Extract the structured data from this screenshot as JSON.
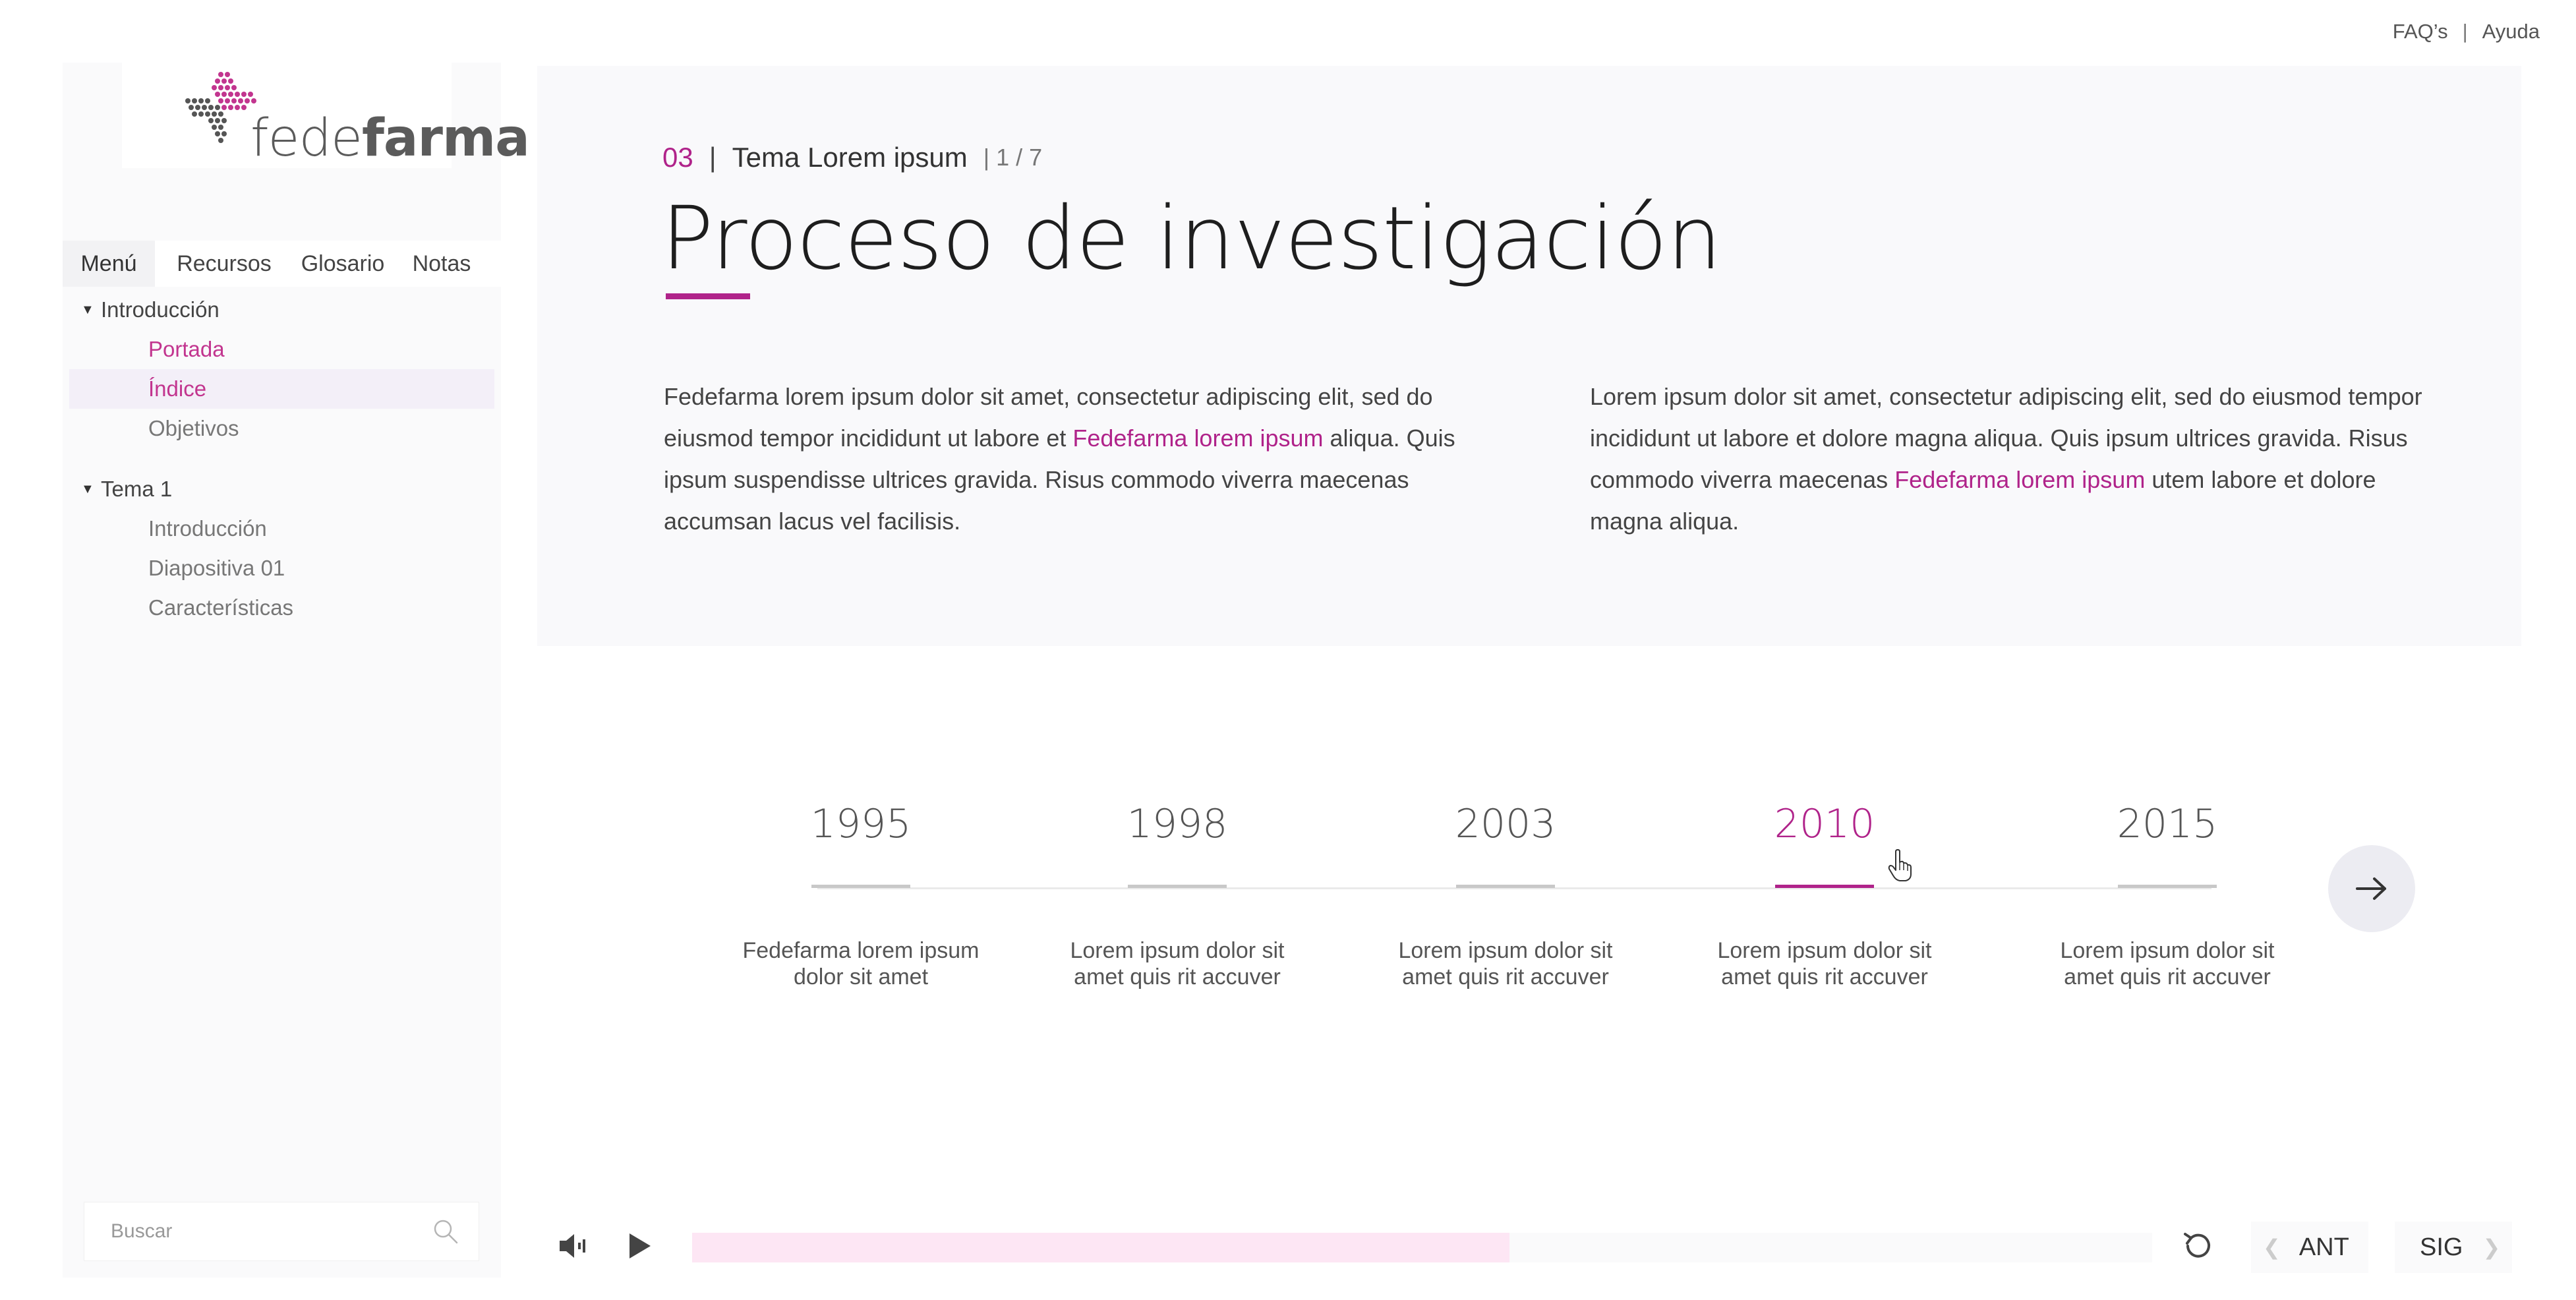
{
  "top_links": {
    "faq": "FAQ’s",
    "separator": "|",
    "help": "Ayuda"
  },
  "logo": {
    "text_light": "fede",
    "text_bold": "farma"
  },
  "sidebar": {
    "tabs": [
      {
        "label": "Menú",
        "active": true
      },
      {
        "label": "Recursos",
        "active": false
      },
      {
        "label": "Glosario",
        "active": false
      },
      {
        "label": "Notas",
        "active": false
      }
    ],
    "groups": [
      {
        "title": "Introducción",
        "items": [
          {
            "label": "Portada",
            "state": "visited"
          },
          {
            "label": "Índice",
            "state": "current"
          },
          {
            "label": "Objetivos",
            "state": "default"
          }
        ]
      },
      {
        "title": "Tema 1",
        "items": [
          {
            "label": "Introducción",
            "state": "default"
          },
          {
            "label": "Diapositiva 01",
            "state": "default"
          },
          {
            "label": "Características",
            "state": "default"
          }
        ]
      }
    ],
    "search_placeholder": "Buscar"
  },
  "header": {
    "number": "03",
    "separator": "|",
    "topic": "Tema Lorem ipsum",
    "pages": "| 1 / 7",
    "title": "Proceso de investigación"
  },
  "paragraphs": {
    "left": {
      "before": "Fedefarma lorem ipsum dolor sit amet, consectetur adipiscing elit, sed do eiusmod tempor incididunt ut labore et ",
      "highlight": "Fedefarma lorem ipsum",
      "after": " aliqua. Quis ipsum suspendisse ultrices gravida. Risus commodo viverra maecenas accumsan lacus vel facilisis."
    },
    "right": {
      "before": "Lorem ipsum dolor sit amet, consectetur adipiscing elit, sed do eiusmod tempor incididunt ut labore et dolore magna aliqua. Quis ipsum ultrices gravida. Risus commodo viverra maecenas ",
      "highlight": "Fedefarma lorem ipsum",
      "after": " utem labore et dolore magna aliqua."
    }
  },
  "timeline": [
    {
      "year": "1995",
      "desc_line1": "Fedefarma lorem ipsum",
      "desc_line2": "dolor sit amet",
      "active": false
    },
    {
      "year": "1998",
      "desc_line1": "Lorem ipsum dolor sit",
      "desc_line2": "amet quis rit accuver",
      "active": false
    },
    {
      "year": "2003",
      "desc_line1": "Lorem ipsum dolor sit",
      "desc_line2": "amet quis rit accuver",
      "active": false
    },
    {
      "year": "2010",
      "desc_line1": "Lorem ipsum dolor sit",
      "desc_line2": "amet quis rit accuver",
      "active": true
    },
    {
      "year": "2015",
      "desc_line1": "Lorem ipsum dolor sit",
      "desc_line2": "amet quis rit accuver",
      "active": false
    }
  ],
  "player": {
    "progress_fraction": 0.56,
    "prev_label": "ANT",
    "next_label": "SIG"
  },
  "colors": {
    "accent": "#b0238a",
    "accent_light": "#c2358f",
    "progress_fill": "#fde6f4",
    "panel_bg": "#f9f9fb"
  },
  "icons": {
    "volume": "volume-icon",
    "play": "play-icon",
    "replay": "replay-icon",
    "search": "search-icon",
    "next": "arrow-right-icon",
    "cursor": "hand-cursor-icon"
  }
}
